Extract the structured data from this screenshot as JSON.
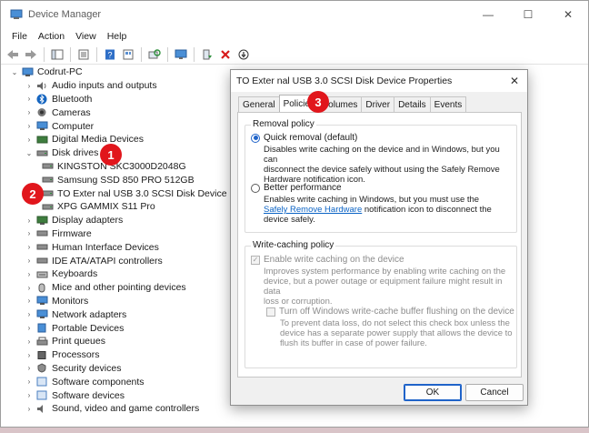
{
  "window": {
    "title": "Device Manager",
    "controls": {
      "minimize": "—",
      "maximize": "☐",
      "close": "✕"
    }
  },
  "menu": [
    "File",
    "Action",
    "View",
    "Help"
  ],
  "tree": {
    "root": "Codrut-PC",
    "categories": [
      "Audio inputs and outputs",
      "Bluetooth",
      "Cameras",
      "Computer",
      "Digital Media Devices",
      "Disk drives",
      "Display adapters",
      "Firmware",
      "Human Interface Devices",
      "IDE ATA/ATAPI controllers",
      "Keyboards",
      "Mice and other pointing devices",
      "Monitors",
      "Network adapters",
      "Portable Devices",
      "Print queues",
      "Processors",
      "Security devices",
      "Software components",
      "Software devices",
      "Sound, video and game controllers"
    ],
    "disk_drives": [
      "KINGSTON SKC3000D2048G",
      "Samsung SSD 850 PRO 512GB",
      "TO Exter nal USB 3.0 SCSI Disk Device",
      "XPG GAMMIX S11 Pro"
    ]
  },
  "badges": {
    "b1": "1",
    "b2": "2",
    "b3": "3"
  },
  "dialog": {
    "title": "TO Exter nal USB 3.0 SCSI Disk Device Properties",
    "close": "✕",
    "tabs": [
      "General",
      "Policies",
      "Volumes",
      "Driver",
      "Details",
      "Events"
    ],
    "active_tab": "Policies",
    "removal_policy": {
      "label": "Removal policy",
      "quick": {
        "label": "Quick removal (default)",
        "desc_lines": [
          "Disables write caching on the device and in Windows, but you can",
          "disconnect the device safely without using the Safely Remove",
          "Hardware notification icon."
        ]
      },
      "better": {
        "label": "Better performance",
        "desc_line1": "Enables write caching in Windows, but you must use the",
        "link": "Safely Remove Hardware",
        "desc_line2_rest": " notification icon to disconnect the",
        "desc_line3": "device safely."
      }
    },
    "write_caching": {
      "label": "Write-caching policy",
      "enable": {
        "label": "Enable write caching on the device",
        "desc_lines": [
          "Improves system performance by enabling write caching on the",
          "device, but a power outage or equipment failure might result in data",
          "loss or corruption."
        ]
      },
      "turn_off": {
        "label": "Turn off Windows write-cache buffer flushing on the device",
        "desc_lines": [
          "To prevent data loss, do not select this check box unless the",
          "device has a separate power supply that allows the device to",
          "flush its buffer in case of power failure."
        ]
      }
    },
    "ok": "OK",
    "cancel": "Cancel"
  },
  "colors": {
    "accent": "#1f63c9",
    "badge": "#e1161c",
    "link": "#0b63c5"
  }
}
